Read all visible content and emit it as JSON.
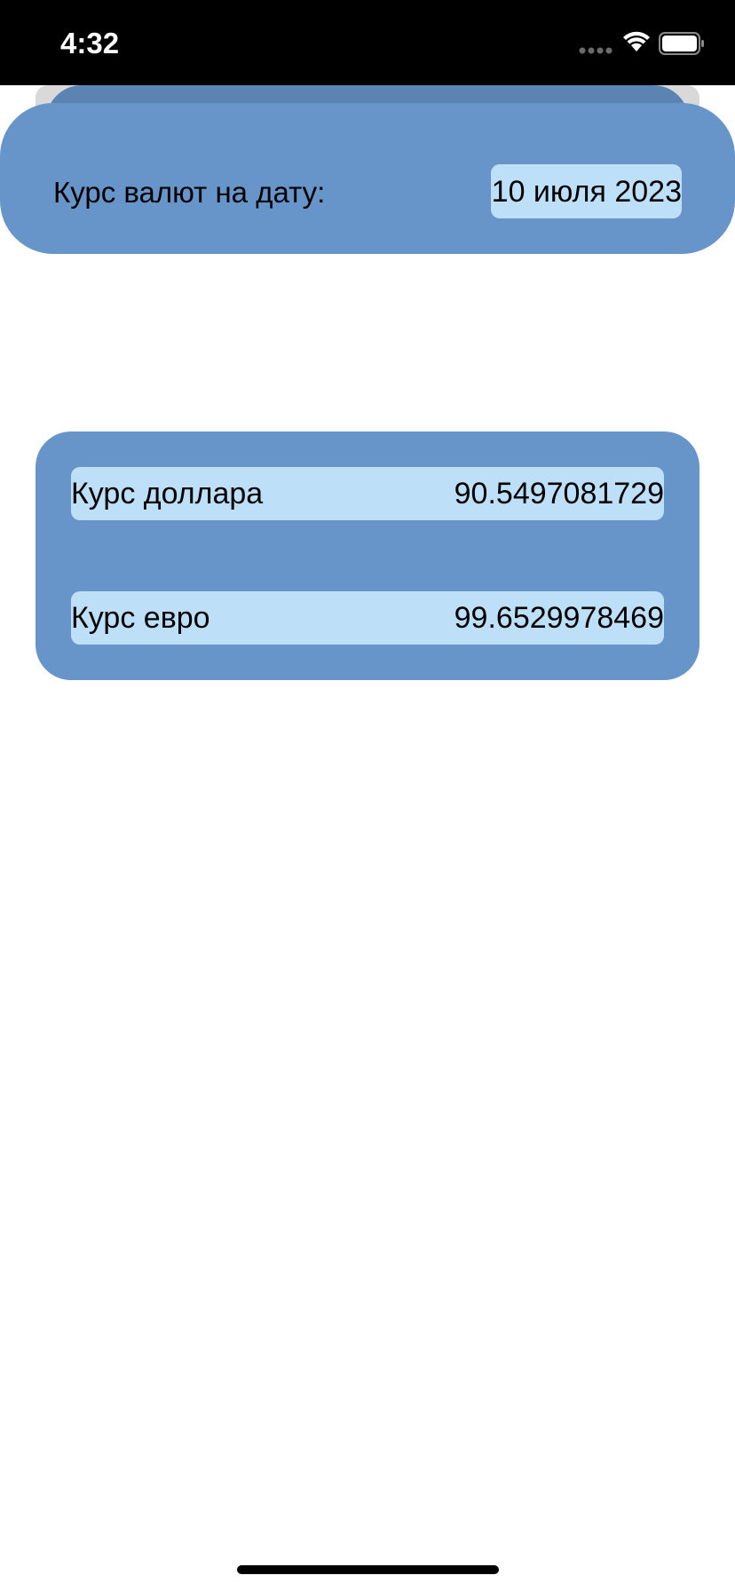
{
  "status_bar": {
    "time": "4:32",
    "icons": [
      "signal-icon",
      "wifi-icon",
      "battery-icon"
    ]
  },
  "date_panel": {
    "label": "Курс валют на дату:",
    "date_value": "10 июля 2023"
  },
  "rates": {
    "usd": {
      "label": "Курс доллара",
      "value": "90.5497081729"
    },
    "eur": {
      "label": "Курс евро",
      "value": "99.6529978469"
    }
  },
  "colors": {
    "card_blue": "#6795c9",
    "field_light_blue": "#bde0f8",
    "status_bar_bg": "#000000"
  }
}
